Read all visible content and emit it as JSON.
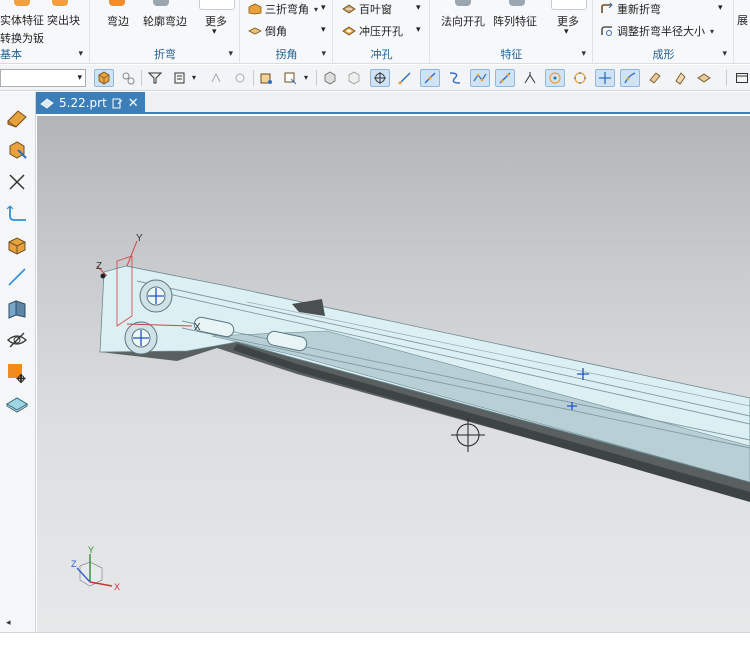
{
  "ribbon": {
    "groups": [
      {
        "label": "基本",
        "buttons": [
          "实体特征",
          "转换为钣"
        ],
        "extra": "突出块"
      },
      {
        "label": "折弯",
        "buttons": [
          "弯边",
          "轮廓弯边",
          "更多"
        ]
      },
      {
        "label": "拐角",
        "buttons": [
          "三折弯角",
          "倒角"
        ]
      },
      {
        "label": "冲孔",
        "buttons": [
          "百叶窗",
          "冲压开孔"
        ]
      },
      {
        "label": "特征",
        "buttons": [
          "法向开孔",
          "阵列特征",
          "更多"
        ]
      },
      {
        "label": "成形",
        "buttons": [
          "重新折弯",
          "调整折弯半径大小"
        ],
        "extra": "展"
      }
    ]
  },
  "toolbar2": {
    "filter_value": ""
  },
  "document": {
    "tab_label": "5.22.prt",
    "close_symbol": "✕"
  },
  "viewport": {
    "csys_labels": {
      "z": "Z",
      "y": "Y",
      "x": "X"
    },
    "triad_labels": {
      "z": "Z",
      "y": "Y",
      "x": "X"
    }
  },
  "colors": {
    "accent": "#3c7fb8",
    "part_face": "#d8eef3",
    "part_edge": "#4b5152",
    "ribbon_label": "#1f5f8f",
    "marker_blue": "#1f55c8"
  },
  "icons": [
    "cursor-crosshair-icon",
    "csys-icon",
    "view-triad-icon"
  ]
}
